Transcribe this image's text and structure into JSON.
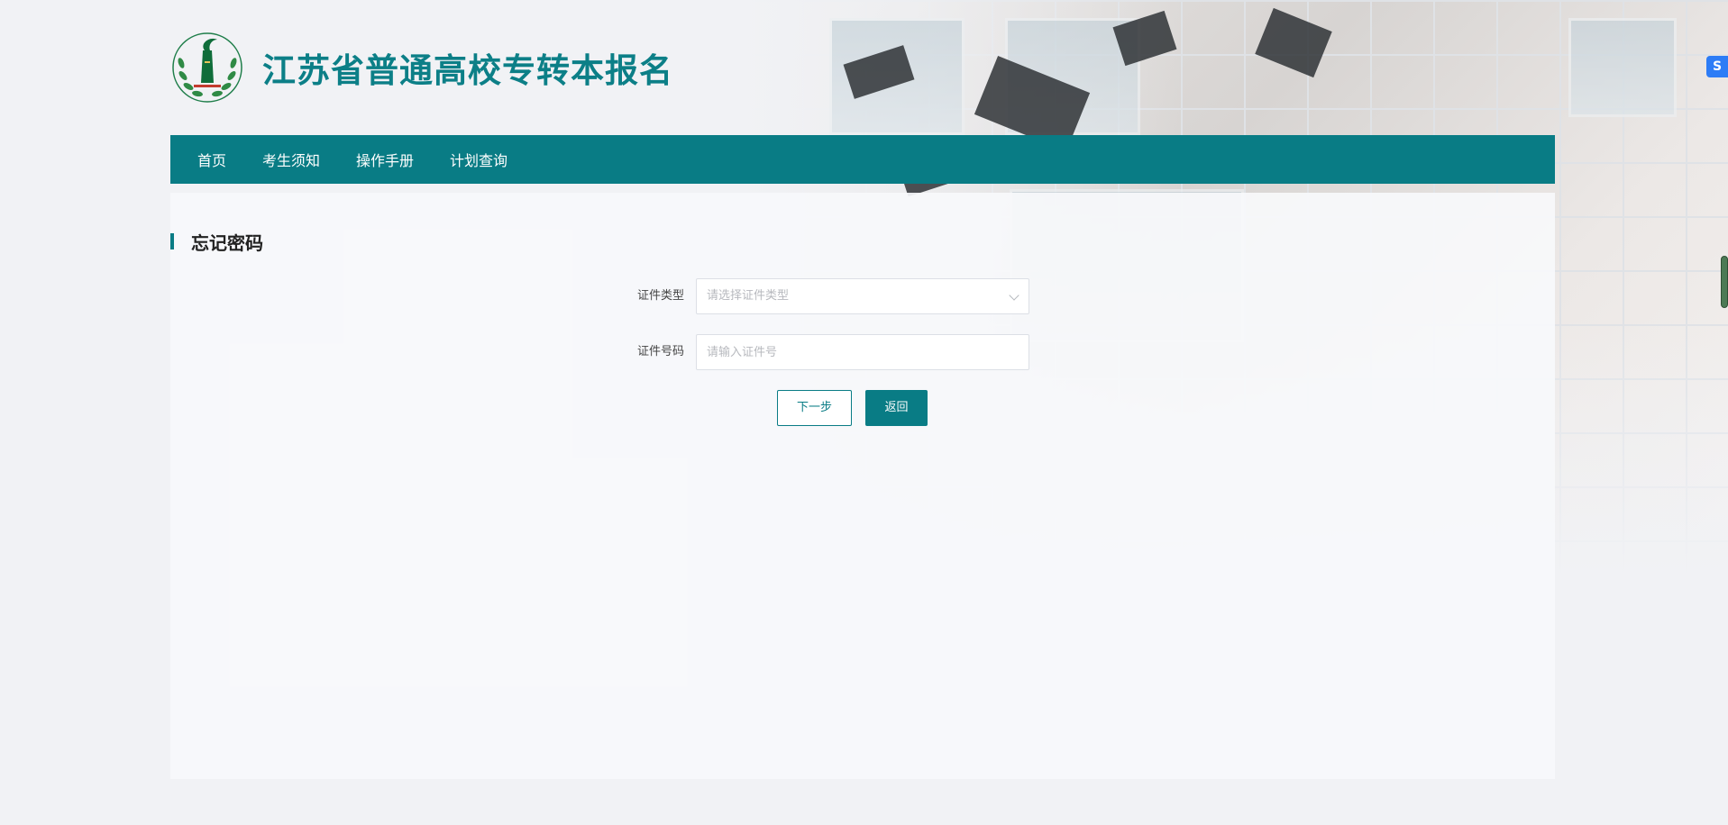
{
  "site": {
    "title": "江苏省普通高校专转本报名"
  },
  "nav": {
    "items": [
      {
        "label": "首页"
      },
      {
        "label": "考生须知"
      },
      {
        "label": "操作手册"
      },
      {
        "label": "计划查询"
      }
    ]
  },
  "form": {
    "section_title": "忘记密码",
    "id_type": {
      "label": "证件类型",
      "placeholder": "请选择证件类型"
    },
    "id_number": {
      "label": "证件号码",
      "placeholder": "请输入证件号"
    },
    "buttons": {
      "next_label": "下一步",
      "back_label": "返回"
    }
  },
  "colors": {
    "brand": "#097c85",
    "title": "#0c7f87"
  },
  "icons": {
    "logo": "school-emblem-icon",
    "select_arrow": "chevron-down-icon",
    "floating_widget": "translate-icon"
  }
}
